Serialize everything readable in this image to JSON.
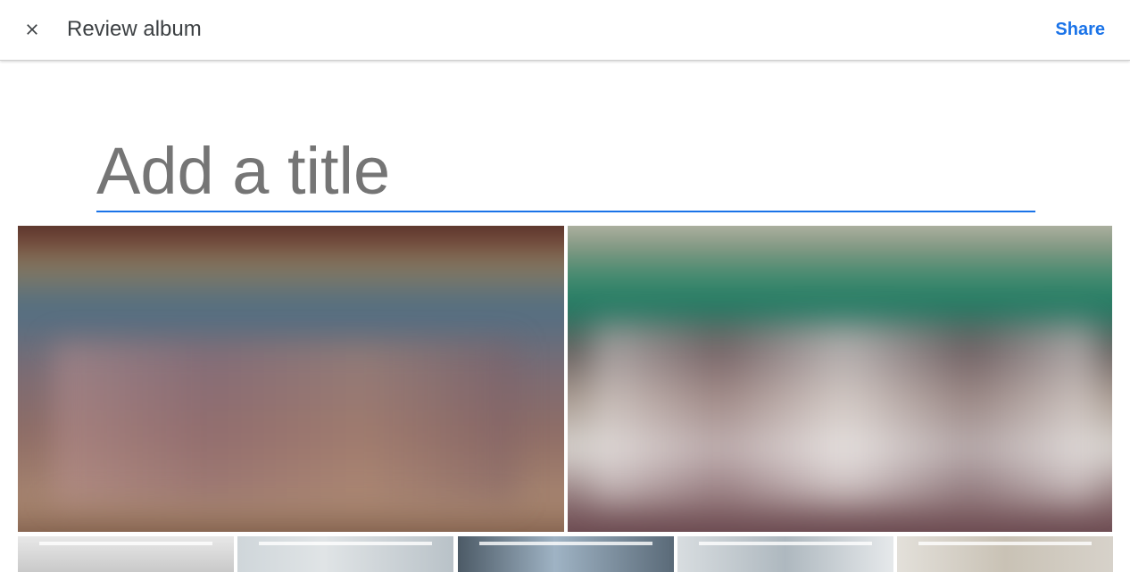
{
  "header": {
    "title": "Review album",
    "share_label": "Share",
    "close_icon": "close-icon"
  },
  "album": {
    "title_placeholder": "Add a title",
    "title_value": "",
    "accent_color": "#1a73e8"
  },
  "photos": {
    "large": [
      {
        "name": "photo-1",
        "description": ""
      },
      {
        "name": "photo-2",
        "description": ""
      }
    ],
    "thumbnail_count": 5
  }
}
